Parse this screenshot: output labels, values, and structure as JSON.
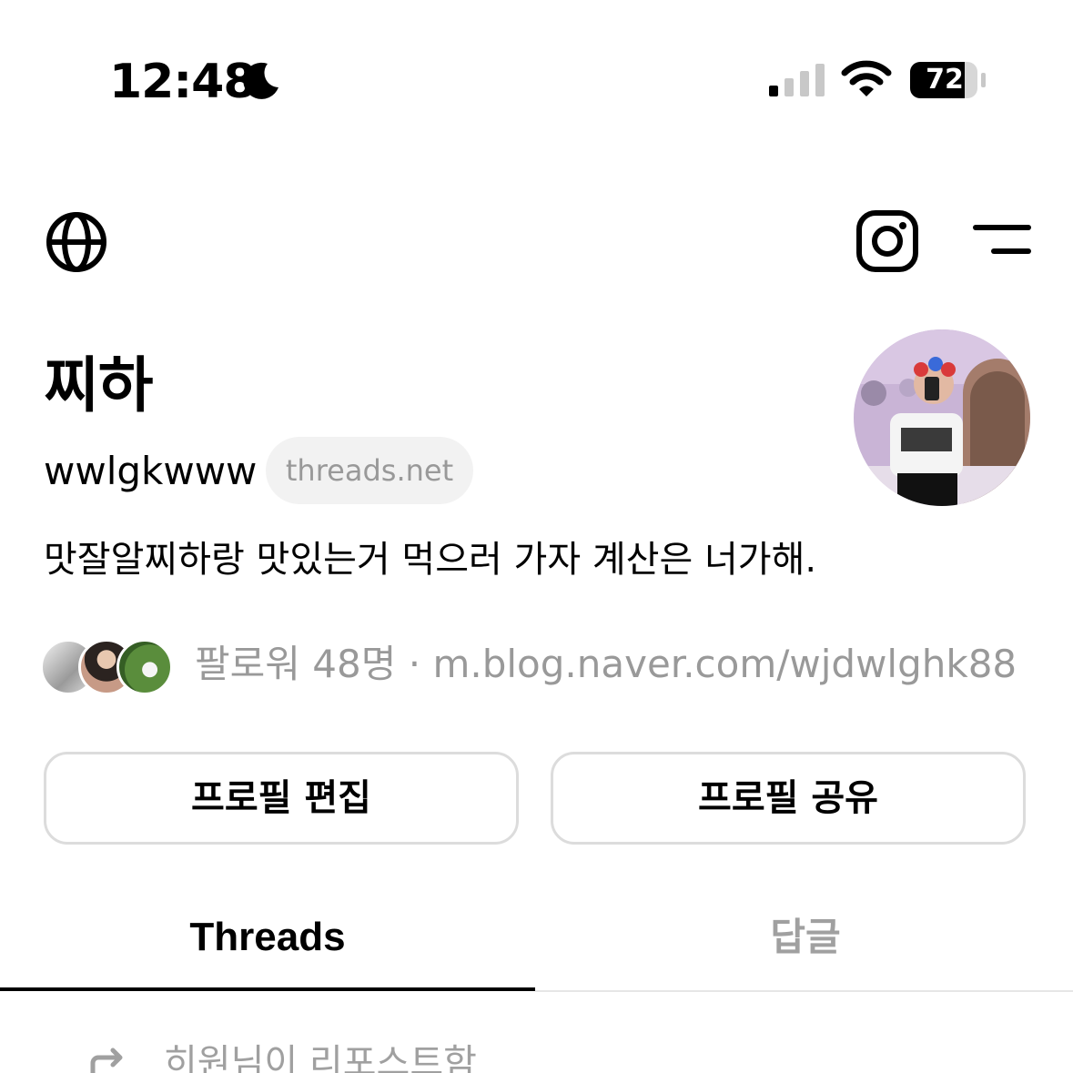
{
  "status_bar": {
    "time": "12:48",
    "battery": "72",
    "icons": [
      "moon-icon",
      "cellular-signal-icon",
      "wifi-icon",
      "battery-icon"
    ]
  },
  "top_nav": {
    "icons": [
      "globe-icon",
      "instagram-icon",
      "menu-icon"
    ]
  },
  "profile": {
    "name": "찌하",
    "username": "wwlgkwww",
    "domain_badge": "threads.net",
    "bio": "맛잘알찌하랑 맛있는거 먹으러 가자 계산은 너가해.",
    "followers_text": "팔로워 48명",
    "separator": "·",
    "link": "m.blog.naver.com/wjdwlghk88"
  },
  "buttons": {
    "edit_profile": "프로필 편집",
    "share_profile": "프로필 공유"
  },
  "tabs": [
    {
      "label": "Threads",
      "active": true
    },
    {
      "label": "답글",
      "active": false
    }
  ],
  "feed": {
    "repost_text": "히원님이 리포스트함"
  },
  "colors": {
    "text_primary": "#000000",
    "text_secondary": "#999999",
    "border": "#dcdcdc",
    "badge_bg": "#f2f2f2"
  }
}
